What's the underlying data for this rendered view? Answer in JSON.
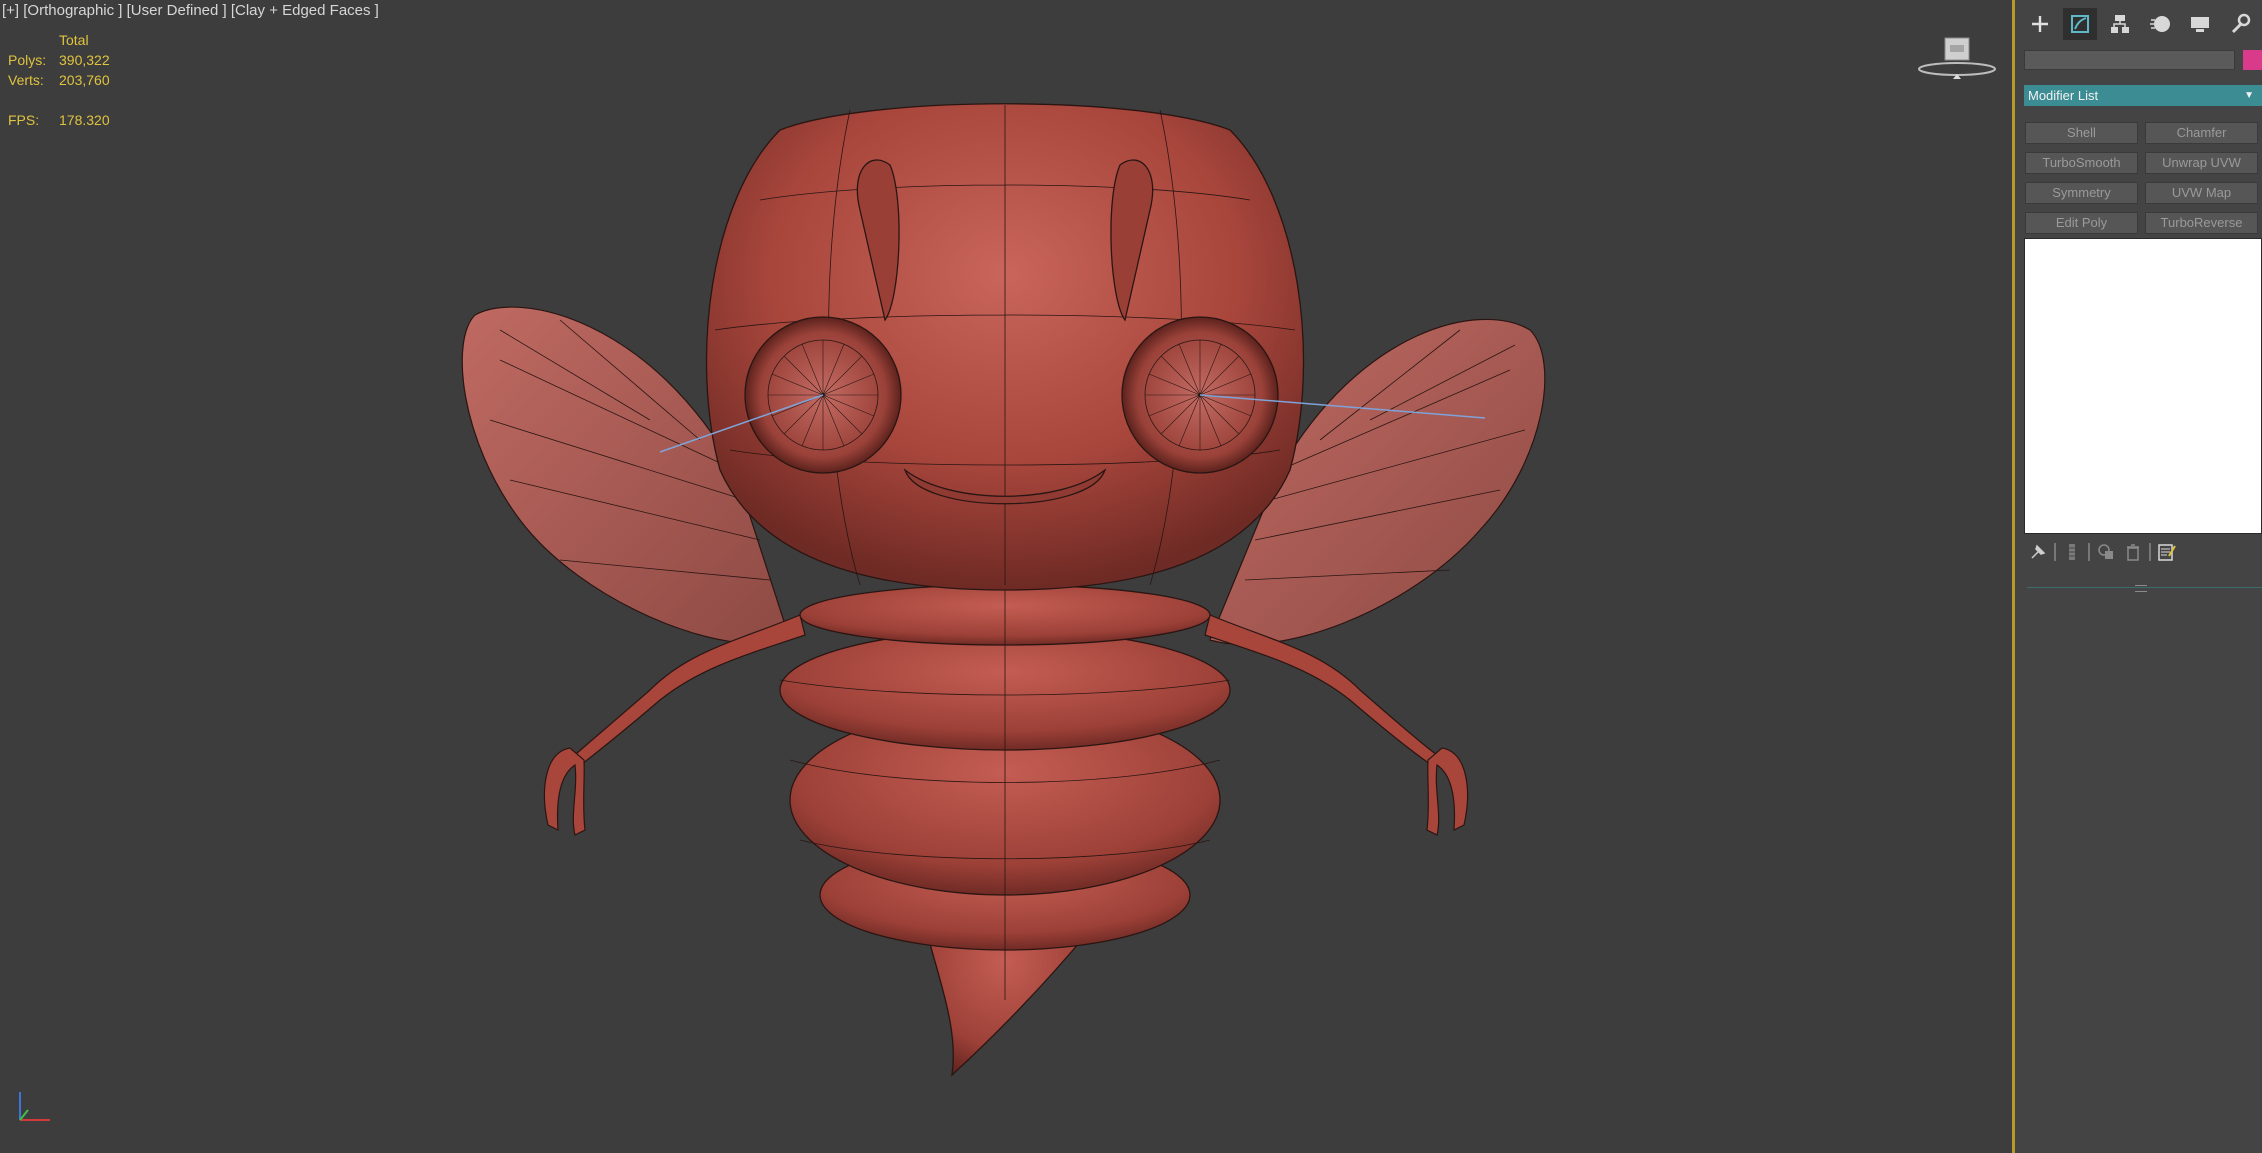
{
  "viewport": {
    "label": "[+] [Orthographic ] [User Defined ] [Clay + Edged Faces ]",
    "stats": {
      "header": "Total",
      "polys_label": "Polys:",
      "polys_value": "390,322",
      "verts_label": "Verts:",
      "verts_value": "203,760",
      "fps_label": "FPS:",
      "fps_value": "178.320"
    },
    "viewcube_icon": "viewcube-icon",
    "axis_icon": "axis-tripod-icon",
    "model_color": "#b0453c"
  },
  "command_panel": {
    "tabs": [
      {
        "icon": "create-icon"
      },
      {
        "icon": "modify-icon",
        "active": true
      },
      {
        "icon": "hierarchy-icon"
      },
      {
        "icon": "motion-icon"
      },
      {
        "icon": "display-icon"
      },
      {
        "icon": "utilities-icon"
      }
    ],
    "object_name": "",
    "object_color": "#d93a8a",
    "modifier_list_label": "Modifier List",
    "modifier_buttons": [
      "Shell",
      "Chamfer",
      "TurboSmooth",
      "Unwrap UVW",
      "Symmetry",
      "UVW Map",
      "Edit Poly",
      "TurboReverse"
    ],
    "stack_tools": [
      "pin-stack-icon",
      "show-end-result-icon",
      "make-unique-icon",
      "remove-modifier-icon",
      "configure-modifier-sets-icon"
    ]
  }
}
